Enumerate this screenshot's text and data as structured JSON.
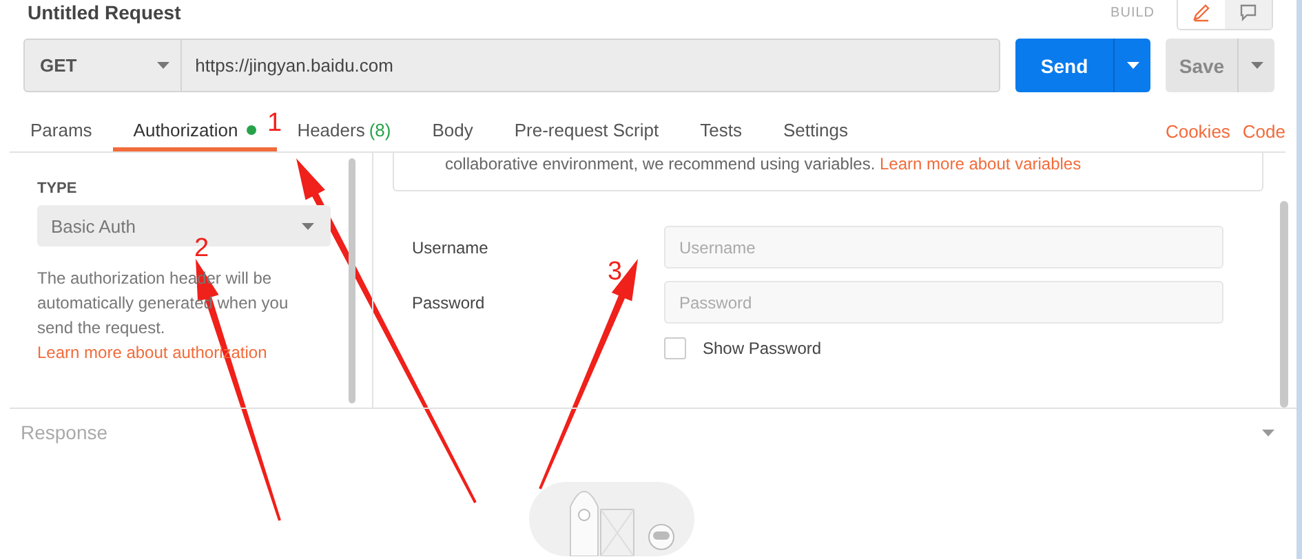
{
  "window": {
    "title": "Untitled Request",
    "mode_label": "BUILD"
  },
  "view_modes": [
    {
      "kind": "edit",
      "selected": true
    },
    {
      "kind": "comment",
      "selected": false
    }
  ],
  "request": {
    "method": "GET",
    "url": "https://jingyan.baidu.com",
    "send": "Send",
    "save": "Save"
  },
  "tabs": [
    {
      "label": "Params",
      "selected": false,
      "indicator": false
    },
    {
      "label": "Authorization",
      "selected": true,
      "indicator": true
    },
    {
      "label": "Headers",
      "count": "(8)",
      "selected": false,
      "indicator": false
    },
    {
      "label": "Body",
      "selected": false,
      "indicator": false
    },
    {
      "label": "Pre-request Script",
      "selected": false,
      "indicator": false
    },
    {
      "label": "Tests",
      "selected": false,
      "indicator": false
    },
    {
      "label": "Settings",
      "selected": false,
      "indicator": false
    }
  ],
  "tab_links": [
    "Cookies",
    "Code"
  ],
  "auth": {
    "type_label": "TYPE",
    "type_value": "Basic Auth",
    "description": "The authorization header will be automatically generated when you send the request.",
    "description_link": "Learn more about authorization"
  },
  "note": {
    "text": "collaborative environment, we recommend using variables.",
    "link": "Learn more about variables"
  },
  "fields": [
    {
      "label": "Username",
      "placeholder": "Username"
    },
    {
      "label": "Password",
      "placeholder": "Password"
    }
  ],
  "show_password": {
    "label": "Show Password",
    "checked": false
  },
  "response": {
    "title": "Response"
  },
  "annotations": [
    {
      "label": "1"
    },
    {
      "label": "2"
    },
    {
      "label": "3"
    }
  ]
}
